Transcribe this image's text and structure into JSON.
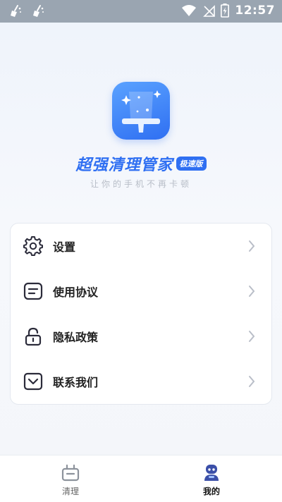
{
  "status_bar": {
    "time": "12:57",
    "icons": [
      "broom-notification-icon",
      "broom-notification-icon",
      "wifi-icon",
      "no-sim-icon",
      "battery-charging-icon"
    ]
  },
  "header": {
    "app_name": "超强清理管家",
    "badge": "极速版",
    "slogan": "让你的手机不再卡顿"
  },
  "menu": {
    "items": [
      {
        "label": "设置",
        "icon": "gear-icon"
      },
      {
        "label": "使用协议",
        "icon": "document-icon"
      },
      {
        "label": "隐私政策",
        "icon": "lock-icon"
      },
      {
        "label": "联系我们",
        "icon": "contact-icon"
      }
    ]
  },
  "bottom_nav": {
    "tabs": [
      {
        "label": "清理",
        "icon": "clean-icon",
        "active": false
      },
      {
        "label": "我的",
        "icon": "profile-icon",
        "active": true
      }
    ]
  },
  "colors": {
    "accent": "#2f6ff2",
    "status_bar": "#9aa5b1",
    "inactive_text": "#666666",
    "active_text": "#111111"
  }
}
